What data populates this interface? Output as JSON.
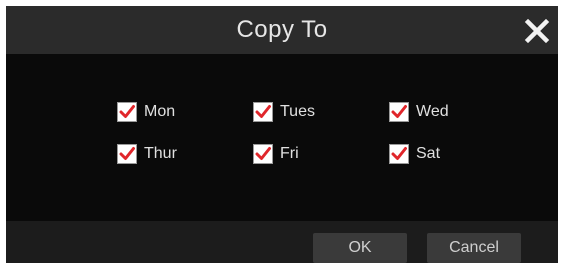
{
  "dialog": {
    "title": "Copy To",
    "close_icon": "close-icon"
  },
  "days": [
    {
      "label": "Mon",
      "checked": true
    },
    {
      "label": "Tues",
      "checked": true
    },
    {
      "label": "Wed",
      "checked": true
    },
    {
      "label": "Thur",
      "checked": true
    },
    {
      "label": "Fri",
      "checked": true
    },
    {
      "label": "Sat",
      "checked": true
    }
  ],
  "buttons": {
    "ok_label": "OK",
    "cancel_label": "Cancel"
  },
  "colors": {
    "check_mark": "#e0262b",
    "title_bar": "#2b2b2b",
    "body": "#0a0a0a",
    "footer": "#1c1c1c",
    "button": "#3a3a3a"
  }
}
